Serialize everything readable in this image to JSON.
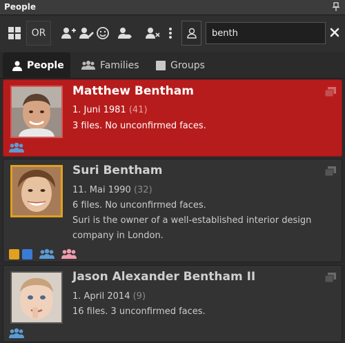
{
  "window": {
    "title": "People"
  },
  "toolbar": {
    "or_label": "OR",
    "search_value": "benth",
    "search_placeholder": ""
  },
  "tabs": [
    {
      "label": "People",
      "active": true
    },
    {
      "label": "Families",
      "active": false
    },
    {
      "label": "Groups",
      "active": false
    }
  ],
  "people": [
    {
      "name": "Matthew Bentham",
      "birth": "1. Juni 1981",
      "age": "(41)",
      "files": "3 files. No unconfirmed faces.",
      "selected": true
    },
    {
      "name": "Suri Bentham",
      "birth": "11. Mai 1990",
      "age": "(32)",
      "files": "6 files. No unconfirmed faces.",
      "description": [
        "Suri is the owner of a well-established interior design",
        "company in London."
      ],
      "tag_colors": [
        "#e0a020",
        "#3a7bd5"
      ]
    },
    {
      "name": "Jason Alexander Bentham II",
      "birth": "1. April 2014",
      "age": "(9)",
      "files": "16 files. 3 unconfirmed faces."
    }
  ],
  "colors": {
    "selected_bg": "#b71c1c",
    "group_icon_blue": "#5b9bd5",
    "group_icon_pink": "#f29bb0",
    "tag_orange": "#e0a020",
    "tag_blue": "#3a7bd5"
  }
}
